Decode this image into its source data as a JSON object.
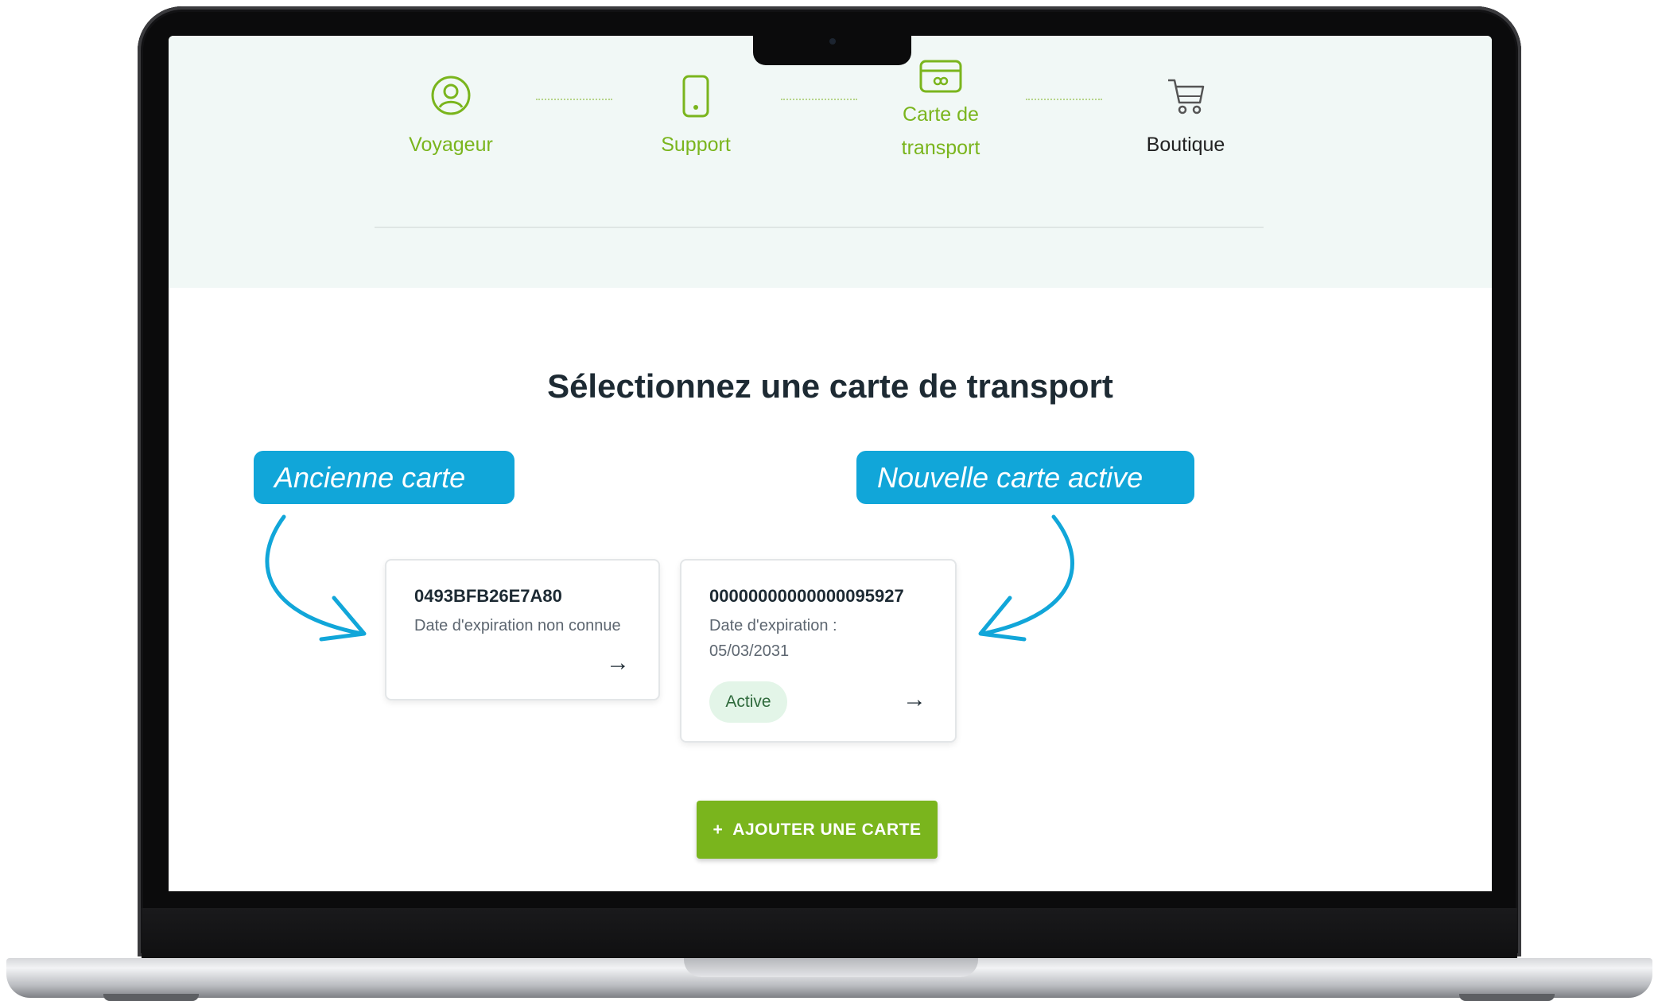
{
  "stepper": {
    "steps": [
      {
        "label": "Voyageur",
        "icon": "user-circle-icon",
        "state": "done"
      },
      {
        "label": "Support",
        "icon": "phone-icon",
        "state": "done"
      },
      {
        "label_line1": "Carte de",
        "label_line2": "transport",
        "icon": "card-icon",
        "state": "done"
      },
      {
        "label": "Boutique",
        "icon": "cart-icon",
        "state": "current"
      }
    ]
  },
  "main": {
    "title": "Sélectionnez une carte de transport",
    "cards": [
      {
        "number": "0493BFB26E7A80",
        "expiry": "Date d'expiration non connue",
        "arrow": "→"
      },
      {
        "number": "00000000000000095927",
        "expiry_line1": "Date d'expiration :",
        "expiry_line2": "05/03/2031",
        "badge": "Active",
        "arrow": "→"
      }
    ],
    "add_button": {
      "plus": "+",
      "label": "AJOUTER UNE CARTE"
    }
  },
  "annotations": {
    "old_card": "Ancienne carte",
    "new_card": "Nouvelle carte active"
  },
  "colors": {
    "accent_green": "#7ab51d",
    "callout_blue": "#11a6d9",
    "stepper_bg": "#f1f8f6",
    "badge_bg": "#e3f5e8"
  }
}
